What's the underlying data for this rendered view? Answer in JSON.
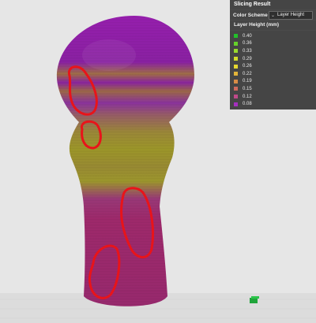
{
  "panel": {
    "title": "Slicing Result",
    "color_scheme_label": "Color Scheme",
    "color_scheme_value": "Layer Height",
    "legend_title": "Layer Height (mm)",
    "legend": [
      {
        "value": "0.40",
        "color": "#22c02a"
      },
      {
        "value": "0.36",
        "color": "#66d12a"
      },
      {
        "value": "0.33",
        "color": "#9ad92e"
      },
      {
        "value": "0.29",
        "color": "#d2dc2a"
      },
      {
        "value": "0.26",
        "color": "#e6d830"
      },
      {
        "value": "0.22",
        "color": "#e2b43a"
      },
      {
        "value": "0.19",
        "color": "#d88c46"
      },
      {
        "value": "0.15",
        "color": "#cf6a5e"
      },
      {
        "value": "0.12",
        "color": "#c04a8a"
      },
      {
        "value": "0.08",
        "color": "#a52fc0"
      }
    ]
  },
  "colors": {
    "background": "#e6e6e6",
    "annotation_outline": "#e8141a",
    "sphere": "#8e22a2",
    "band": "#9b6a4a",
    "neck": "#a09a2e",
    "base": "#a02a6e"
  }
}
